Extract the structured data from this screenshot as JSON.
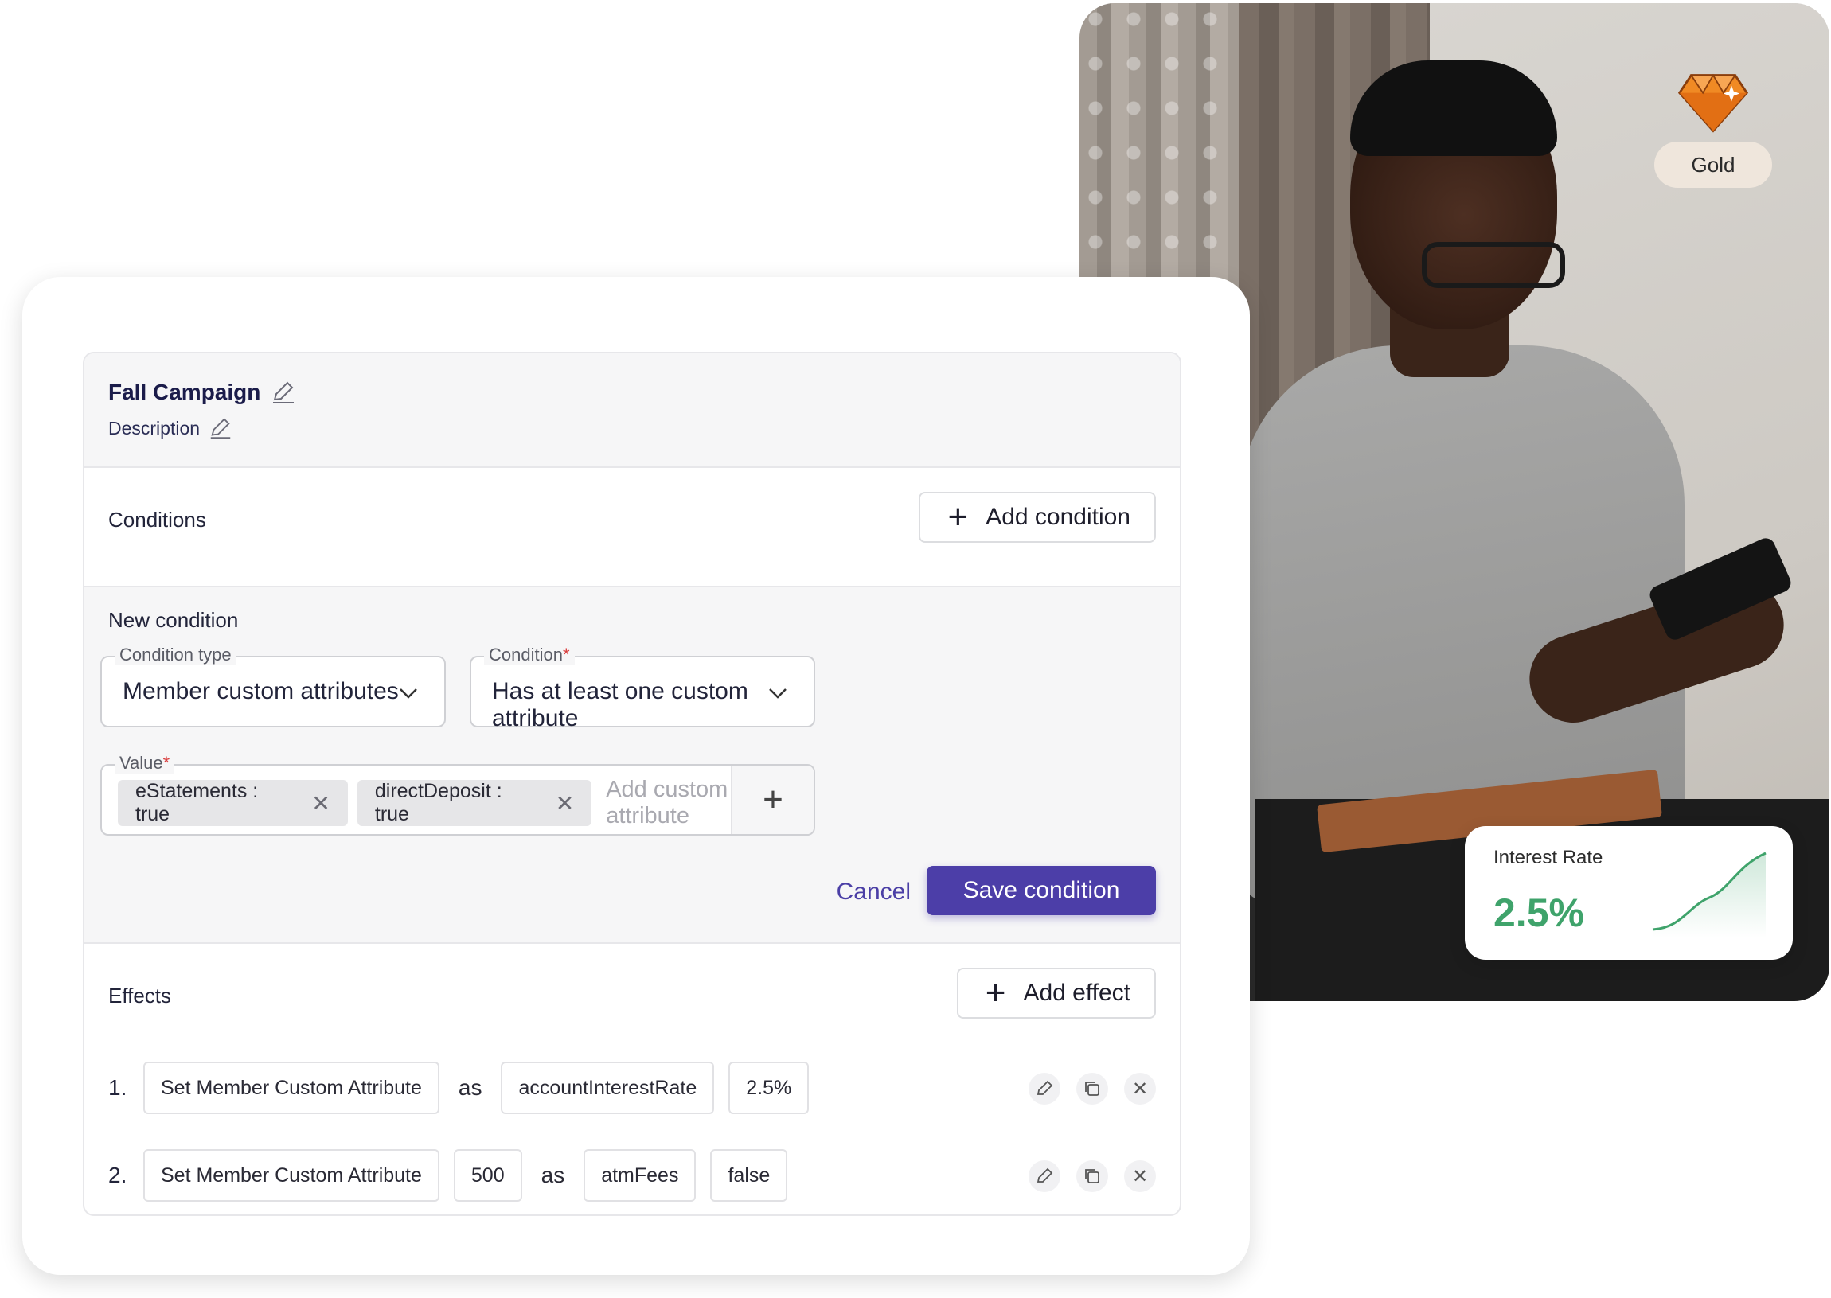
{
  "badge": {
    "tier_label": "Gold",
    "gem_color": "#f08a24"
  },
  "rate_card": {
    "label": "Interest Rate",
    "value": "2.5%",
    "accent": "#3fa36b"
  },
  "campaign": {
    "title": "Fall Campaign",
    "description": "Description"
  },
  "conditions": {
    "label": "Conditions",
    "add_button": "Add condition"
  },
  "new_condition": {
    "title": "New condition",
    "condition_type": {
      "label": "Condition type",
      "value": "Member custom attributes"
    },
    "condition": {
      "label": "Condition",
      "required": "*",
      "value": "Has at least one custom attribute"
    },
    "value_field": {
      "label": "Value",
      "required": "*",
      "chips": [
        "eStatements : true",
        "directDeposit : true"
      ],
      "placeholder": "Add custom attribute"
    },
    "cancel": "Cancel",
    "save": "Save condition",
    "accent": "#4c3ea8"
  },
  "effects": {
    "label": "Effects",
    "add_button": "Add effect",
    "rows": [
      {
        "num": "1.",
        "action": "Set Member Custom Attribute",
        "as": "as",
        "attr": "accountInterestRate",
        "value": "2.5%"
      },
      {
        "num": "2.",
        "action": "Set Member Custom Attribute",
        "amount": "500",
        "as": "as",
        "attr": "atmFees",
        "value": "false"
      }
    ]
  }
}
